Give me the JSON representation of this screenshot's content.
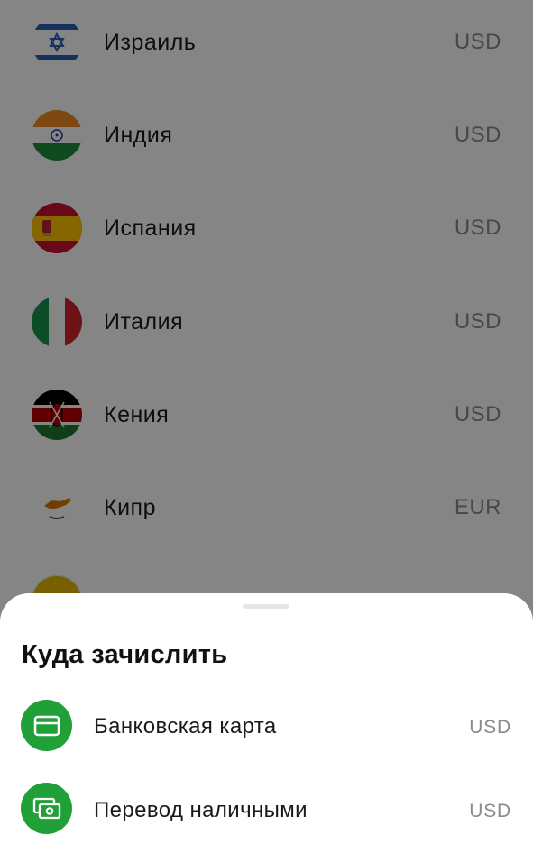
{
  "countries": [
    {
      "name": "Израиль",
      "currency": "USD",
      "flag": "israel-flag"
    },
    {
      "name": "Индия",
      "currency": "USD",
      "flag": "india-flag"
    },
    {
      "name": "Испания",
      "currency": "USD",
      "flag": "spain-flag"
    },
    {
      "name": "Италия",
      "currency": "USD",
      "flag": "italy-flag"
    },
    {
      "name": "Кения",
      "currency": "USD",
      "flag": "kenya-flag"
    },
    {
      "name": "Кипр",
      "currency": "EUR",
      "flag": "cyprus-flag"
    }
  ],
  "sheet": {
    "title": "Куда зачислить",
    "options": [
      {
        "label": "Банковская карта",
        "currency": "USD",
        "icon": "bank-card-icon"
      },
      {
        "label": "Перевод наличными",
        "currency": "USD",
        "icon": "cash-transfer-icon"
      }
    ]
  },
  "colors": {
    "accent": "#21a038",
    "overlay": "rgba(0,0,0,0.48)"
  }
}
